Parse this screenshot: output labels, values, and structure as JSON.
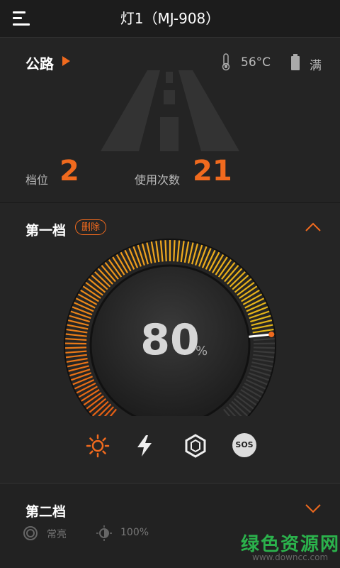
{
  "header": {
    "title": "灯1（MJ-908）",
    "menu_icon": "hamburger-menu-icon"
  },
  "status": {
    "mode_label": "公路",
    "temperature": "56°C",
    "battery": "满",
    "gear_label": "档位",
    "gear_value": "2",
    "count_label": "使用次数",
    "count_value": "21"
  },
  "level1": {
    "title": "第一档",
    "delete_label": "删除",
    "percent": "80",
    "percent_unit": "%",
    "brightness_level": 0.8,
    "modes": [
      {
        "name": "sun-mode-icon",
        "active": true
      },
      {
        "name": "flash-mode-icon",
        "active": false
      },
      {
        "name": "strobe-mode-icon",
        "active": false
      },
      {
        "name": "sos-mode-icon",
        "label": "SOS",
        "active": false
      }
    ]
  },
  "level2": {
    "title": "第二档",
    "mode_label": "常亮",
    "brightness_label": "100%"
  },
  "watermark": {
    "text": "绿色资源网",
    "url": "www.downcc.com"
  },
  "colors": {
    "accent": "#f06a1e",
    "background": "#202020",
    "text_muted": "#bbbbbb"
  }
}
